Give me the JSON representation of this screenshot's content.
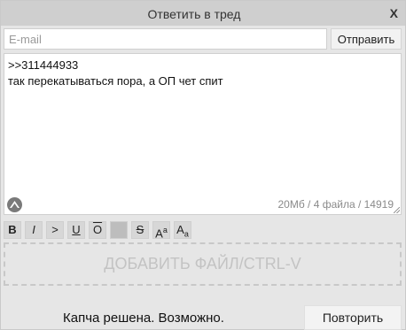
{
  "dialog": {
    "title": "Ответить в тред",
    "close_label": "X"
  },
  "email": {
    "placeholder": "E-mail",
    "value": ""
  },
  "send_button": {
    "label": "Отправить"
  },
  "message": {
    "line1": ">>311444933",
    "line2": "так перекатываться пора, а ОП чет спит"
  },
  "limits_text": "20Мб / 4 файла / 14919",
  "toolbar": {
    "bold": "B",
    "italic": "I",
    "quote": ">",
    "underline": "U",
    "overline": "O",
    "spoiler": "",
    "strike": "S",
    "sup_main": "A",
    "sup_small": "a",
    "sub_main": "A",
    "sub_small": "a"
  },
  "dropzone": {
    "label": "ДОБАВИТЬ ФАЙЛ/CTRL-V"
  },
  "captcha": {
    "status": "Капча решена. Возможно.",
    "retry_label": "Повторить"
  },
  "icons": {
    "sage": "sage-icon"
  }
}
